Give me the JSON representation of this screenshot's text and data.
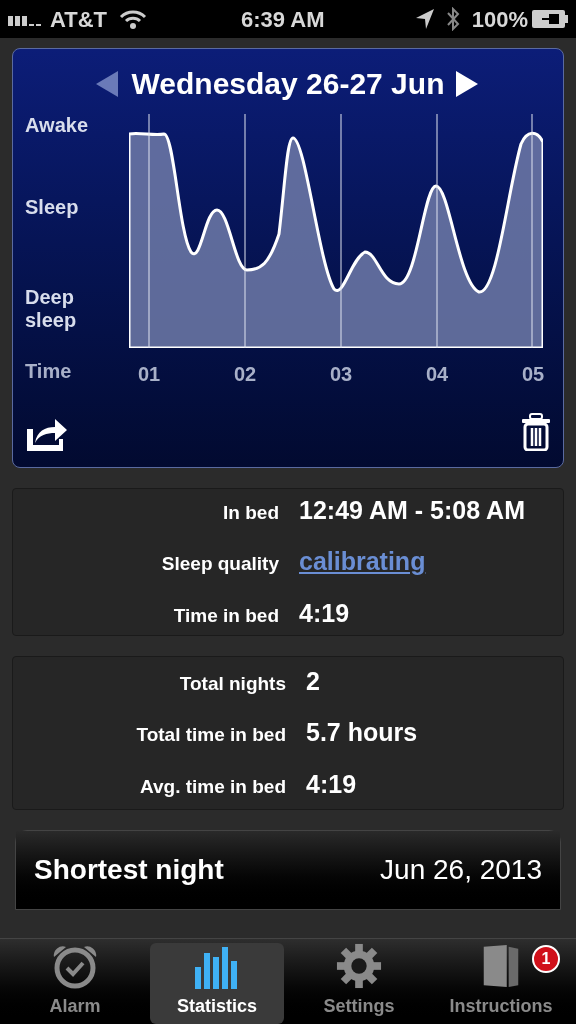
{
  "status_bar": {
    "carrier": "AT&T",
    "time": "6:39 AM",
    "battery": "100%"
  },
  "graph": {
    "title": "Wednesday 26-27 Jun",
    "prev_disabled": true,
    "next_disabled": false,
    "y_labels": [
      "Awake",
      "Sleep",
      "Deep sleep"
    ],
    "x_title": "Time",
    "x_labels": [
      "01",
      "02",
      "03",
      "04",
      "05"
    ]
  },
  "night": [
    {
      "label": "In bed",
      "value": "12:49 AM - 5:08 AM",
      "kind": "text"
    },
    {
      "label": "Sleep quality",
      "value": "calibrating",
      "kind": "link"
    },
    {
      "label": "Time in bed",
      "value": "4:19",
      "kind": "text"
    }
  ],
  "totals": [
    {
      "label": "Total nights",
      "value": "2"
    },
    {
      "label": "Total time in bed",
      "value": "5.7 hours"
    },
    {
      "label": "Avg. time in bed",
      "value": "4:19"
    }
  ],
  "record": {
    "label": "Shortest night",
    "value": "Jun 26, 2013"
  },
  "tabs": [
    {
      "label": "Alarm",
      "kind": "alarm",
      "selected": false
    },
    {
      "label": "Statistics",
      "kind": "stats",
      "selected": true
    },
    {
      "label": "Settings",
      "kind": "gear",
      "selected": false
    },
    {
      "label": "Instructions",
      "kind": "book",
      "selected": false,
      "badge": "1"
    }
  ]
}
